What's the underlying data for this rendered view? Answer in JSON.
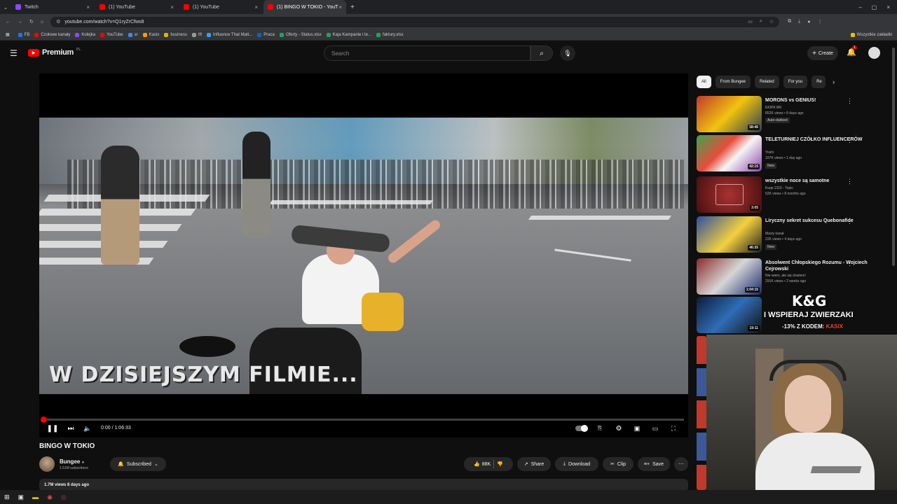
{
  "browser": {
    "tabs": [
      {
        "label": "Twitch",
        "color": "#9146ff"
      },
      {
        "label": "(1) YouTube",
        "color": "#ff0000"
      },
      {
        "label": "(1) YouTube",
        "color": "#ff0000"
      },
      {
        "label": "(1) BINGO W TOKIO - YouT",
        "color": "#ff0000",
        "active": true
      }
    ],
    "url": "youtube.com/watch?v=Q1ryZrCfws8",
    "bookmarks": [
      "FB",
      "Czołowe kanały",
      "Kolejka",
      "YouTube",
      "sr",
      "Kasix",
      "business",
      "tft",
      "Influence That Matt...",
      "Praca",
      "Oferty - Status.xlsx",
      "Kaja Kampanie i te...",
      "faktury.xlsx"
    ],
    "all_bookmarks": "Wszystkie zakładki"
  },
  "header": {
    "logo": "Premium",
    "region": "PL",
    "search_placeholder": "Search",
    "create_label": "Create",
    "notif_count": "1"
  },
  "player": {
    "overlay_text": "W DZISIEJSZYM FILMIE...",
    "time": "0:00 / 1:06:33",
    "progress": 0.0
  },
  "video": {
    "title": "BINGO W TOKIO",
    "channel": "Bungee",
    "subscribers": "1.51M subscribers",
    "subscribed_label": "Subscribed",
    "likes": "88K",
    "share": "Share",
    "download": "Download",
    "clip": "Clip",
    "save": "Save",
    "desc_meta": "1.7M views  8 days ago"
  },
  "sidebar": {
    "chips": [
      "All",
      "From Bungee",
      "Related",
      "For you",
      "Re"
    ],
    "recs": [
      {
        "title": "MORONS vs GENIUS!",
        "channel": "EKIPA WK",
        "meta": "852K views • 8 days ago",
        "badge": "Auto-dubbed",
        "dur": "58:46",
        "thumb": "#b5322a"
      },
      {
        "title": "TELETURNIEJ CZÓŁKO INFLUENCERÓW",
        "channel": "Yoshi",
        "meta": "107K views • 1 day ago",
        "badge": "New",
        "dur": "42:15",
        "thumb": "#2f7d3a"
      },
      {
        "title": "wszystkie noce są samotne",
        "channel": "Kuqe 2115 - Topic",
        "meta": "52K views • 8 months ago",
        "badge": "",
        "dur": "3:05",
        "thumb": "#7a1c1c"
      },
      {
        "title": "Liryczny sekret sukcesu Quebonafide",
        "channel": "Maxiy kanał",
        "meta": "22K views • 4 days ago",
        "badge": "New",
        "dur": "46:35",
        "thumb": "#3a5ea8"
      },
      {
        "title": "Absolwent Chłopskiego Rozumu - Wojciech Cejrowski",
        "channel": "Nie wiem, ale się dowiem!",
        "meta": "291K views • 2 weeks ago",
        "badge": "",
        "dur": "1:04:15",
        "thumb": "#8c2a2a"
      },
      {
        "title": "",
        "channel": "",
        "meta": "",
        "badge": "",
        "dur": "19:11",
        "thumb": "#1d2a4a"
      }
    ]
  },
  "promo": {
    "brand": "K&G",
    "line1": "I WSPIERAJ ZWIERZAKI",
    "line2": "-13% Z KODEM:",
    "code": "KASIX"
  }
}
